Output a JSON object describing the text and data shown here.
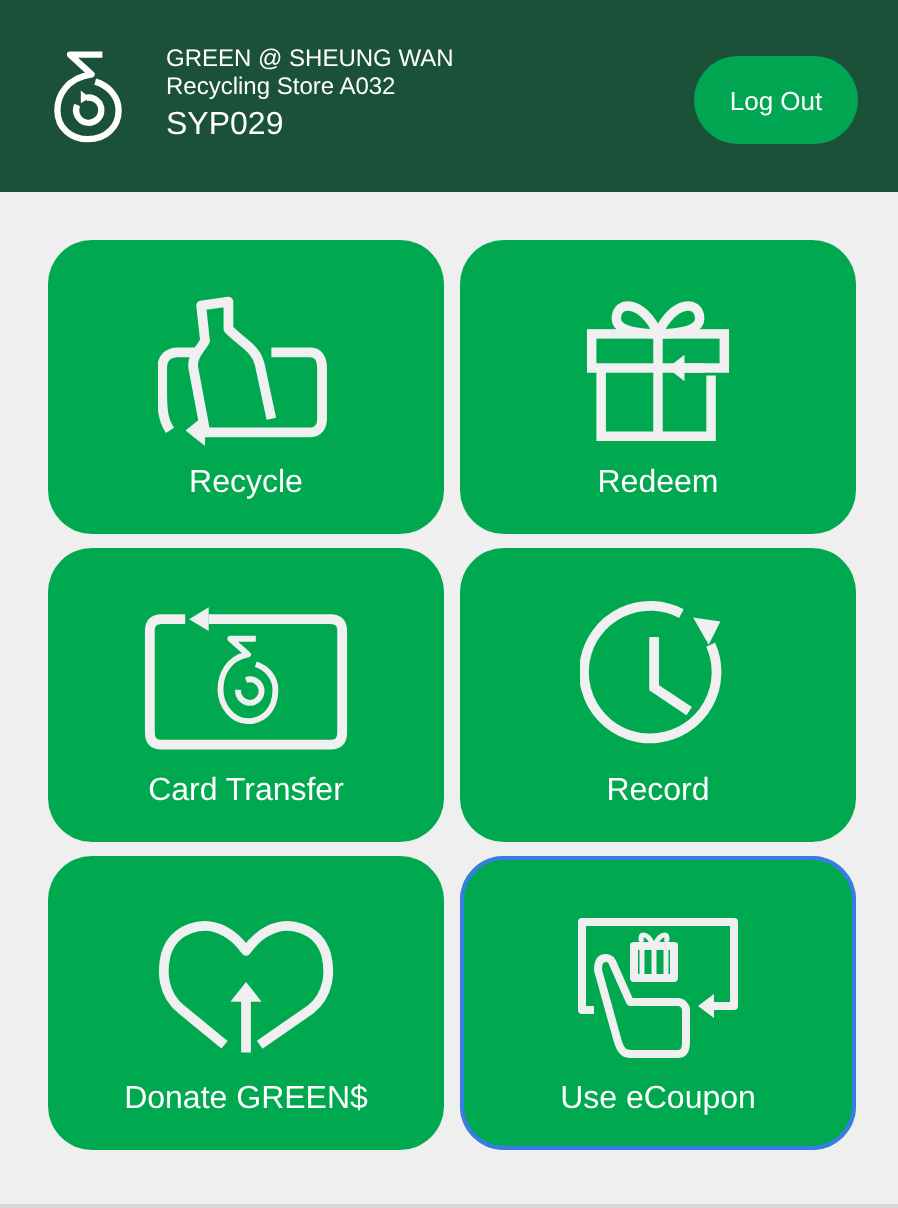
{
  "header": {
    "store_name": "GREEN @ SHEUNG WAN",
    "store_subtitle": "Recycling Store A032",
    "user_id": "SYP029",
    "logout_button": "Log Out"
  },
  "tiles": [
    {
      "kind": "recycle",
      "label": "Recycle",
      "focused": false
    },
    {
      "kind": "redeem",
      "label": "Redeem",
      "focused": false
    },
    {
      "kind": "transfer",
      "label": "Card Transfer",
      "focused": false
    },
    {
      "kind": "record",
      "label": "Record",
      "focused": false
    },
    {
      "kind": "donate",
      "label": "Donate GREEN$",
      "focused": false
    },
    {
      "kind": "ecoupon",
      "label": "Use eCoupon",
      "focused": true
    }
  ]
}
